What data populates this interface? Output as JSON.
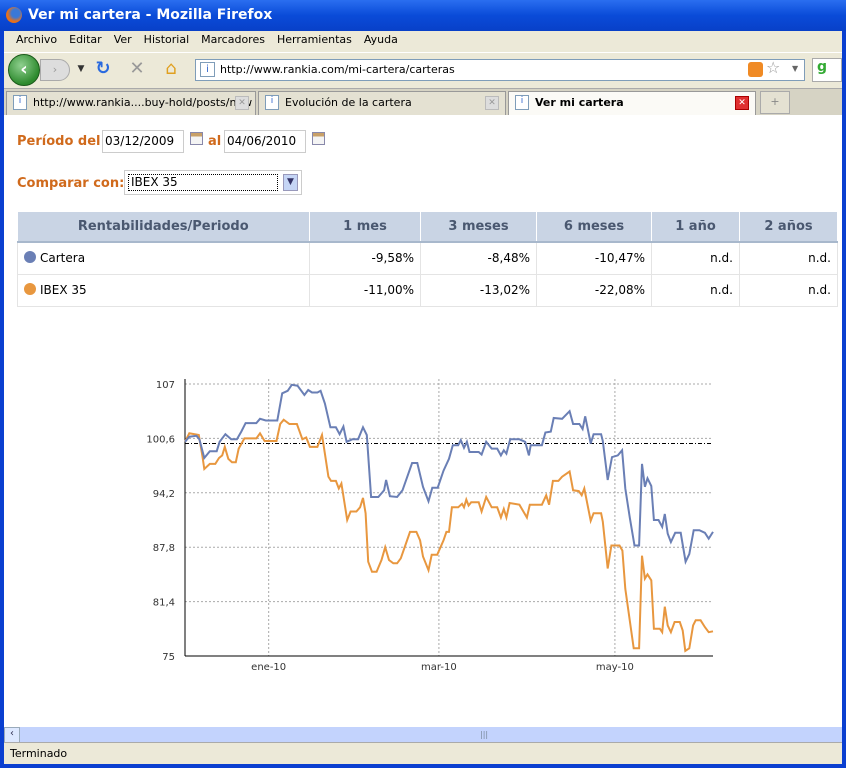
{
  "window": {
    "title": "Ver mi cartera - Mozilla Firefox"
  },
  "menu": [
    "Archivo",
    "Editar",
    "Ver",
    "Historial",
    "Marcadores",
    "Herramientas",
    "Ayuda"
  ],
  "address": {
    "url": "http://www.rankia.com/mi-cartera/carteras"
  },
  "tabs": [
    {
      "label": "http://www.rankia....buy-hold/posts/new"
    },
    {
      "label": "Evolución de la cartera"
    },
    {
      "label": "Ver mi cartera"
    }
  ],
  "form": {
    "period_label": "Período del",
    "from": "03/12/2009",
    "to_label": "al",
    "to": "04/06/2010",
    "compare_label": "Comparar con:",
    "compare_value": "IBEX 35"
  },
  "table": {
    "headers": [
      "Rentabilidades/Periodo",
      "1 mes",
      "3 meses",
      "6 meses",
      "1 año",
      "2 años"
    ],
    "rows": [
      {
        "name": "Cartera",
        "color": "#6a7fb5",
        "values": [
          "-9,58%",
          "-8,48%",
          "-10,47%",
          "n.d.",
          "n.d."
        ]
      },
      {
        "name": "IBEX 35",
        "color": "#e8973f",
        "values": [
          "-11,00%",
          "-13,02%",
          "-22,08%",
          "n.d.",
          "n.d."
        ]
      }
    ]
  },
  "chart_data": {
    "type": "line",
    "xlabel": "",
    "ylabel": "",
    "x_unit": "days since 03/12/2009",
    "xlim": [
      0,
      183
    ],
    "ylim": [
      75,
      107
    ],
    "yticks": [
      "75",
      "81,4",
      "87,8",
      "94,2",
      "100,6",
      "107"
    ],
    "ytick_values": [
      75,
      81.4,
      87.8,
      94.2,
      100.6,
      107
    ],
    "xticks": [
      {
        "label": "ene-10",
        "day": 29
      },
      {
        "label": "mar-10",
        "day": 88
      },
      {
        "label": "may-10",
        "day": 149
      }
    ],
    "baseline": 100,
    "grid": true,
    "series": [
      {
        "name": "Cartera",
        "color": "#6a7fb5",
        "points": [
          [
            0,
            100.2
          ],
          [
            1.5,
            100.8
          ],
          [
            4,
            100.9
          ],
          [
            5,
            100.5
          ],
          [
            6.7,
            98.3
          ],
          [
            8.6,
            99.1
          ],
          [
            11,
            99.1
          ],
          [
            12,
            100.2
          ],
          [
            14,
            101.1
          ],
          [
            16,
            100.5
          ],
          [
            18,
            100.5
          ],
          [
            19.5,
            101.4
          ],
          [
            21,
            102.4
          ],
          [
            24.7,
            102.4
          ],
          [
            26,
            102.9
          ],
          [
            28,
            102.7
          ],
          [
            32,
            102.7
          ],
          [
            33.7,
            105.9
          ],
          [
            35.6,
            106.2
          ],
          [
            37,
            106.9
          ],
          [
            39,
            106.8
          ],
          [
            41.4,
            105.7
          ],
          [
            42.7,
            106.3
          ],
          [
            44,
            106
          ],
          [
            45.9,
            106
          ],
          [
            47,
            106.2
          ],
          [
            48.5,
            104.7
          ],
          [
            50.4,
            101.9
          ],
          [
            52.3,
            101.9
          ],
          [
            53.6,
            101.1
          ],
          [
            54.9,
            102
          ],
          [
            56,
            100.2
          ],
          [
            58,
            100.5
          ],
          [
            60,
            100.5
          ],
          [
            61.7,
            101.9
          ],
          [
            63,
            101
          ],
          [
            64.5,
            93.7
          ],
          [
            67,
            93.7
          ],
          [
            69,
            94.5
          ],
          [
            69.7,
            95.7
          ],
          [
            71,
            93.8
          ],
          [
            73.5,
            93.7
          ],
          [
            75.4,
            94.5
          ],
          [
            78.7,
            97.7
          ],
          [
            80.5,
            97.7
          ],
          [
            82.5,
            94.9
          ],
          [
            84.4,
            93.2
          ],
          [
            85.7,
            94.8
          ],
          [
            87.6,
            94.8
          ],
          [
            89.6,
            96.8
          ],
          [
            91.5,
            98.2
          ],
          [
            92.8,
            99.8
          ],
          [
            94.7,
            99.8
          ],
          [
            95.6,
            100.4
          ],
          [
            96.7,
            99.5
          ],
          [
            97.7,
            100.2
          ],
          [
            98.6,
            99
          ],
          [
            101.8,
            99
          ],
          [
            102.8,
            98.7
          ],
          [
            104.4,
            100.2
          ],
          [
            106.3,
            99.4
          ],
          [
            108.2,
            99.4
          ],
          [
            109.5,
            98.6
          ],
          [
            110.5,
            99.2
          ],
          [
            111.4,
            98.8
          ],
          [
            112.7,
            100.5
          ],
          [
            115.9,
            100.5
          ],
          [
            117.9,
            100.2
          ],
          [
            119.2,
            98.6
          ],
          [
            119.8,
            99.8
          ],
          [
            123.7,
            99.8
          ],
          [
            124.9,
            101.3
          ],
          [
            126.8,
            101.4
          ],
          [
            127.8,
            103
          ],
          [
            130.7,
            102.9
          ],
          [
            133.3,
            103.8
          ],
          [
            134.5,
            102.3
          ],
          [
            136.7,
            102.3
          ],
          [
            137.8,
            101.7
          ],
          [
            138.7,
            103.2
          ],
          [
            140.6,
            100
          ],
          [
            141.6,
            101.1
          ],
          [
            144.2,
            101.1
          ],
          [
            144.8,
            100.3
          ],
          [
            146.5,
            95.7
          ],
          [
            148,
            98.4
          ],
          [
            150,
            98.6
          ],
          [
            151.5,
            99.2
          ],
          [
            152.6,
            94.7
          ],
          [
            154.2,
            91.2
          ],
          [
            155.8,
            88
          ],
          [
            157.4,
            88
          ],
          [
            158.4,
            97.6
          ],
          [
            159.4,
            94.9
          ],
          [
            160.3,
            95.9
          ],
          [
            161.6,
            95
          ],
          [
            162.5,
            91
          ],
          [
            164.1,
            91
          ],
          [
            165.4,
            90.2
          ],
          [
            166.3,
            91.7
          ],
          [
            167.3,
            89.4
          ],
          [
            168.4,
            88.4
          ],
          [
            169.9,
            89.5
          ],
          [
            171.8,
            89.5
          ],
          [
            173.5,
            86.1
          ],
          [
            174.8,
            87
          ],
          [
            176.3,
            89.8
          ],
          [
            178.3,
            89.8
          ],
          [
            180.2,
            89.5
          ],
          [
            181.5,
            88.8
          ],
          [
            183,
            89.6
          ]
        ]
      },
      {
        "name": "IBEX 35",
        "color": "#e8973f",
        "points": [
          [
            0,
            100.2
          ],
          [
            1.5,
            101.2
          ],
          [
            4.8,
            101
          ],
          [
            6,
            98.6
          ],
          [
            6.7,
            97
          ],
          [
            8.6,
            97.6
          ],
          [
            10.5,
            97.6
          ],
          [
            11.8,
            98.3
          ],
          [
            12.9,
            98.6
          ],
          [
            13.8,
            99.6
          ],
          [
            15,
            98.2
          ],
          [
            16.3,
            97.8
          ],
          [
            17.6,
            97.8
          ],
          [
            18.6,
            99.4
          ],
          [
            20.6,
            100.6
          ],
          [
            24.7,
            100.6
          ],
          [
            26,
            101.2
          ],
          [
            27.6,
            100.3
          ],
          [
            31.7,
            100.3
          ],
          [
            33,
            102.3
          ],
          [
            34.2,
            102.8
          ],
          [
            36.2,
            102.3
          ],
          [
            38.8,
            102.3
          ],
          [
            40.7,
            100.5
          ],
          [
            42,
            100.7
          ],
          [
            43.3,
            99.6
          ],
          [
            45.9,
            99.6
          ],
          [
            47.5,
            101
          ],
          [
            48.5,
            98.8
          ],
          [
            49.7,
            96.1
          ],
          [
            50.6,
            95.6
          ],
          [
            52.3,
            95.6
          ],
          [
            53.3,
            94.7
          ],
          [
            54.2,
            95.3
          ],
          [
            56.2,
            91
          ],
          [
            57.4,
            92
          ],
          [
            59.4,
            92
          ],
          [
            60.7,
            92.5
          ],
          [
            61.7,
            93.6
          ],
          [
            62.6,
            91.8
          ],
          [
            63.5,
            86.1
          ],
          [
            64.8,
            84.9
          ],
          [
            66.4,
            84.9
          ],
          [
            68.1,
            86.3
          ],
          [
            69.4,
            87.8
          ],
          [
            70.7,
            86.3
          ],
          [
            72.2,
            85.9
          ],
          [
            73.5,
            85.9
          ],
          [
            74.8,
            86.5
          ],
          [
            78,
            89.6
          ],
          [
            80.2,
            89.6
          ],
          [
            81.5,
            88.6
          ],
          [
            82.5,
            86.7
          ],
          [
            84.4,
            85.1
          ],
          [
            85.5,
            86.9
          ],
          [
            87.4,
            86.9
          ],
          [
            89.6,
            88.6
          ],
          [
            90.6,
            89.6
          ],
          [
            91.5,
            89.6
          ],
          [
            92.5,
            92.5
          ],
          [
            94.7,
            92.5
          ],
          [
            96,
            92.9
          ],
          [
            96.7,
            92.5
          ],
          [
            97.5,
            93.4
          ],
          [
            98.3,
            92.7
          ],
          [
            99.2,
            93.1
          ],
          [
            101.8,
            93.1
          ],
          [
            102.8,
            92
          ],
          [
            104.4,
            93.7
          ],
          [
            106.3,
            92.5
          ],
          [
            108.2,
            92.5
          ],
          [
            109.5,
            91.3
          ],
          [
            110.5,
            92.3
          ],
          [
            111.4,
            91.3
          ],
          [
            112.5,
            93
          ],
          [
            115.9,
            92.8
          ],
          [
            118.5,
            91.3
          ],
          [
            119.5,
            92.8
          ],
          [
            123.7,
            92.8
          ],
          [
            125.2,
            93.9
          ],
          [
            126.2,
            92.8
          ],
          [
            127.5,
            95.6
          ],
          [
            129.4,
            95.6
          ],
          [
            130.7,
            96.1
          ],
          [
            133.3,
            96.7
          ],
          [
            134.5,
            94.5
          ],
          [
            136.5,
            94.4
          ],
          [
            137.5,
            93.9
          ],
          [
            138.4,
            94.7
          ],
          [
            140.6,
            90.9
          ],
          [
            141.6,
            91.8
          ],
          [
            144.2,
            91.8
          ],
          [
            144.8,
            90.8
          ],
          [
            146.5,
            85.3
          ],
          [
            147.8,
            88
          ],
          [
            150.6,
            88
          ],
          [
            151.6,
            87.4
          ],
          [
            152.6,
            82.9
          ],
          [
            155.5,
            75.9
          ],
          [
            157.4,
            75.9
          ],
          [
            158.4,
            86.8
          ],
          [
            159.4,
            84.1
          ],
          [
            160.3,
            84.6
          ],
          [
            161.6,
            83.9
          ],
          [
            162.5,
            78.2
          ],
          [
            164.6,
            78.2
          ],
          [
            165.4,
            77.8
          ],
          [
            166.3,
            80.8
          ],
          [
            167.3,
            78.6
          ],
          [
            168.4,
            77.8
          ],
          [
            169.7,
            79
          ],
          [
            171.5,
            79
          ],
          [
            172.5,
            78
          ],
          [
            173.4,
            75.6
          ],
          [
            174.8,
            75.9
          ],
          [
            176.1,
            78.6
          ],
          [
            177,
            79.2
          ],
          [
            178.7,
            79.2
          ],
          [
            180.2,
            78.4
          ],
          [
            181.5,
            77.8
          ],
          [
            183,
            77.9
          ]
        ]
      }
    ]
  },
  "status": {
    "text": "Terminado"
  }
}
